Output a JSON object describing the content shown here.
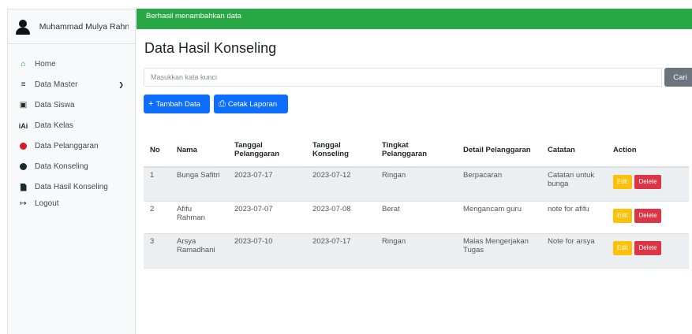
{
  "sidebar": {
    "user_name": "Muhammad Mulya Rahn",
    "items": [
      {
        "label": "Home"
      },
      {
        "label": "Data Master"
      },
      {
        "label": "Data Siswa"
      },
      {
        "label": "Data Kelas"
      },
      {
        "label": "Data Pelanggaran"
      },
      {
        "label": "Data Konseling"
      },
      {
        "label": "Data Hasil Konseling"
      },
      {
        "label": "Logout"
      }
    ]
  },
  "alert": {
    "message": "Berhasil menambahkan data",
    "color": "#28a745"
  },
  "page_title": "Data Hasil Konseling",
  "search": {
    "placeholder": "Masukkan kata kunci",
    "value": "",
    "button_label": "Cari"
  },
  "buttons": {
    "add_label": "Tambah Data",
    "print_label": "Cetak Laporan"
  },
  "table": {
    "headers": [
      "No",
      "Nama",
      "Tanggal Pelanggaran",
      "Tanggal Konseling",
      "Tingkat Pelanggaran",
      "Detail Pelanggaran",
      "Catatan",
      "Action"
    ],
    "rows": [
      {
        "no": "1",
        "nama": "Bunga Safitri",
        "tgl_pelanggaran": "2023-07-17",
        "tgl_konseling": "2023-07-12",
        "tingkat": "Ringan",
        "detail": "Berpacaran",
        "catatan": "Catatan untuk bunga"
      },
      {
        "no": "2",
        "nama": "Afifu Rahman",
        "tgl_pelanggaran": "2023-07-07",
        "tgl_konseling": "2023-07-08",
        "tingkat": "Berat",
        "detail": "Mengancam guru",
        "catatan": "note for afifu"
      },
      {
        "no": "3",
        "nama": "Arsya Ramadhani",
        "tgl_pelanggaran": "2023-07-10",
        "tgl_konseling": "2023-07-17",
        "tingkat": "Ringan",
        "detail": "Malas Mengerjakan Tugas",
        "catatan": "Note for arsya"
      }
    ],
    "edit_label": "Edit",
    "delete_label": "Delete"
  }
}
